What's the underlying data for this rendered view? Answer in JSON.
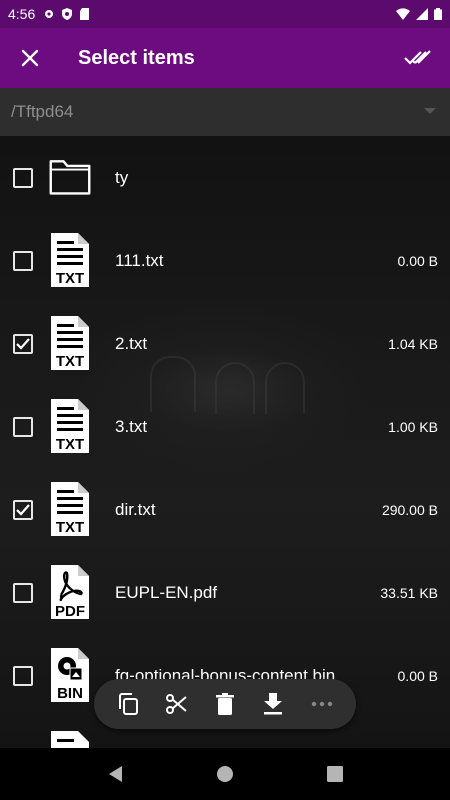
{
  "status_bar": {
    "time": "4:56",
    "icons": [
      "gear-icon",
      "shield-icon",
      "sd-card-icon",
      "wifi-icon",
      "signal-icon",
      "battery-icon"
    ]
  },
  "app_bar": {
    "title": "Select items",
    "close_icon": "close-icon",
    "select_all_icon": "double-check-icon",
    "background": "#6d0c80"
  },
  "path_bar": {
    "path": "/Tftpd64"
  },
  "files": [
    {
      "name": "ty",
      "size": "",
      "type": "folder",
      "checked": false
    },
    {
      "name": "111.txt",
      "size": "0.00 B",
      "type": "TXT",
      "checked": false
    },
    {
      "name": "2.txt",
      "size": "1.04 KB",
      "type": "TXT",
      "checked": true
    },
    {
      "name": "3.txt",
      "size": "1.00 KB",
      "type": "TXT",
      "checked": false
    },
    {
      "name": "dir.txt",
      "size": "290.00 B",
      "type": "TXT",
      "checked": true
    },
    {
      "name": "EUPL-EN.pdf",
      "size": "33.51 KB",
      "type": "PDF",
      "checked": false
    },
    {
      "name": "fg-optional-bonus-content.bin",
      "size": "0.00 B",
      "type": "BIN",
      "checked": false
    }
  ],
  "action_bar": {
    "items": [
      "copy-icon",
      "cut-icon",
      "delete-icon",
      "download-icon",
      "more-icon"
    ]
  },
  "nav_bar": {
    "items": [
      "back-icon",
      "home-icon",
      "recents-icon"
    ]
  }
}
